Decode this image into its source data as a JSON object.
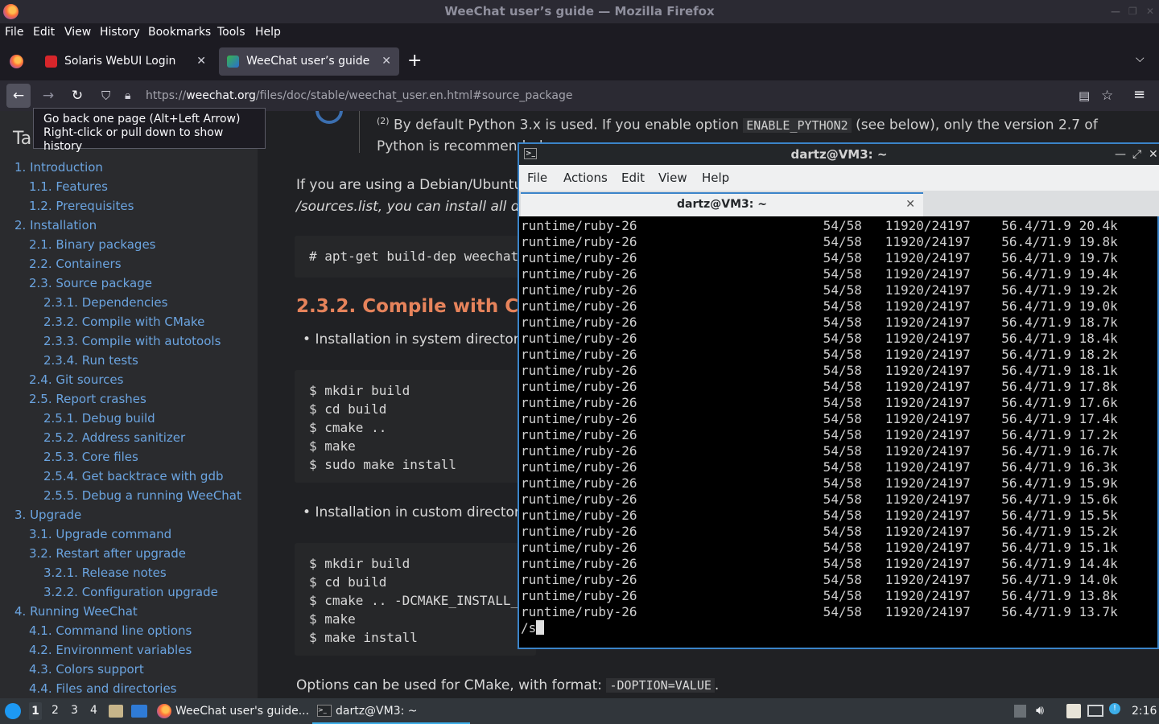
{
  "window": {
    "title": "WeeChat user’s guide — Mozilla Firefox"
  },
  "menu": [
    "File",
    "Edit",
    "View",
    "History",
    "Bookmarks",
    "Tools",
    "Help"
  ],
  "tabs": [
    {
      "label": "Solaris WebUI Login",
      "active": false,
      "favicon": "red"
    },
    {
      "label": "WeeChat user’s guide",
      "active": true,
      "favicon": "weechat"
    }
  ],
  "urlbar": {
    "prefix": "https://",
    "domain": "weechat.org",
    "path": "/files/doc/stable/weechat_user.en.html#source_package"
  },
  "tooltip": {
    "line1": "Go back one page (Alt+Left Arrow)",
    "line2": "Right-click or pull down to show history"
  },
  "sidebar": {
    "title": "Ta",
    "items": [
      "1. Introduction",
      "1.1. Features",
      "1.2. Prerequisites",
      "2. Installation",
      "2.1. Binary packages",
      "2.2. Containers",
      "2.3. Source package",
      "2.3.1. Dependencies",
      "2.3.2. Compile with CMake",
      "2.3.3. Compile with autotools",
      "2.3.4. Run tests",
      "2.4. Git sources",
      "2.5. Report crashes",
      "2.5.1. Debug build",
      "2.5.2. Address sanitizer",
      "2.5.3. Core files",
      "2.5.4. Get backtrace with gdb",
      "2.5.5. Debug a running WeeChat",
      "3. Upgrade",
      "3.1. Upgrade command",
      "3.2. Restart after upgrade",
      "3.2.1. Release notes",
      "3.2.2. Configuration upgrade",
      "4. Running WeeChat",
      "4.1. Command line options",
      "4.2. Environment variables",
      "4.3. Colors support",
      "4.4. Files and directories"
    ]
  },
  "content": {
    "note_sup": "(2)",
    "note_pre": "By default Python 3.x is used. If you enable option",
    "note_code": "ENABLE_PYTHON2",
    "note_post": "(see below), only the version 2.7 of",
    "note_line2": "Python is recommended.",
    "para1": "If you are using a Debian/Ubuntu",
    "para2": "/sources.list, you can install all de",
    "code1": "# apt-get build-dep weechat",
    "heading": "2.3.2. Compile with C",
    "bullet1": "Installation in system directori",
    "code2": "$ mkdir build\n$ cd build\n$ cmake ..\n$ make\n$ sudo make install",
    "bullet2": "Installation in custom director",
    "code3": "$ mkdir build\n$ cd build\n$ cmake .. -DCMAKE_INSTALL_\n$ make\n$ make install",
    "options_pre": "Options can be used for CMake, with format:",
    "options_code": "-DOPTION=VALUE",
    "options_post": "."
  },
  "terminal": {
    "title": "dartz@VM3: ~",
    "menu": [
      "File",
      "Actions",
      "Edit",
      "View",
      "Help"
    ],
    "tab_label": "dartz@VM3: ~",
    "lines": [
      "runtime/ruby-26                        54/58   11920/24197    56.4/71.9 20.4k",
      "runtime/ruby-26                        54/58   11920/24197    56.4/71.9 19.8k",
      "runtime/ruby-26                        54/58   11920/24197    56.4/71.9 19.7k",
      "runtime/ruby-26                        54/58   11920/24197    56.4/71.9 19.4k",
      "runtime/ruby-26                        54/58   11920/24197    56.4/71.9 19.2k",
      "runtime/ruby-26                        54/58   11920/24197    56.4/71.9 19.0k",
      "runtime/ruby-26                        54/58   11920/24197    56.4/71.9 18.7k",
      "runtime/ruby-26                        54/58   11920/24197    56.4/71.9 18.4k",
      "runtime/ruby-26                        54/58   11920/24197    56.4/71.9 18.2k",
      "runtime/ruby-26                        54/58   11920/24197    56.4/71.9 18.1k",
      "runtime/ruby-26                        54/58   11920/24197    56.4/71.9 17.8k",
      "runtime/ruby-26                        54/58   11920/24197    56.4/71.9 17.6k",
      "runtime/ruby-26                        54/58   11920/24197    56.4/71.9 17.4k",
      "runtime/ruby-26                        54/58   11920/24197    56.4/71.9 17.2k",
      "runtime/ruby-26                        54/58   11920/24197    56.4/71.9 16.7k",
      "runtime/ruby-26                        54/58   11920/24197    56.4/71.9 16.3k",
      "runtime/ruby-26                        54/58   11920/24197    56.4/71.9 15.9k",
      "runtime/ruby-26                        54/58   11920/24197    56.4/71.9 15.6k",
      "runtime/ruby-26                        54/58   11920/24197    56.4/71.9 15.5k",
      "runtime/ruby-26                        54/58   11920/24197    56.4/71.9 15.2k",
      "runtime/ruby-26                        54/58   11920/24197    56.4/71.9 15.1k",
      "runtime/ruby-26                        54/58   11920/24197    56.4/71.9 14.4k",
      "runtime/ruby-26                        54/58   11920/24197    56.4/71.9 14.0k",
      "runtime/ruby-26                        54/58   11920/24197    56.4/71.9 13.8k",
      "runtime/ruby-26                        54/58   11920/24197    56.4/71.9 13.7k"
    ],
    "prompt": "/s"
  },
  "taskbar": {
    "workspaces": [
      "1",
      "2",
      "3",
      "4"
    ],
    "tasks": [
      "WeeChat user's guide...",
      "dartz@VM3: ~"
    ],
    "clock": "2:16"
  }
}
